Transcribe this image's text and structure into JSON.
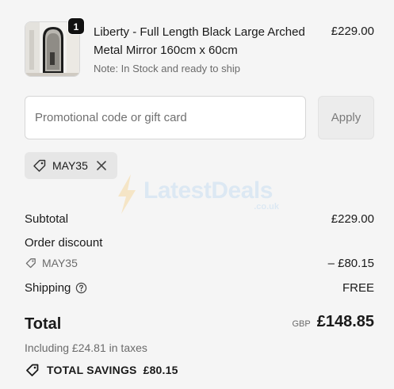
{
  "product": {
    "quantity": "1",
    "title": "Liberty - Full Length Black Large Arched Metal Mirror 160cm x 60cm",
    "note": "Note: In Stock and ready to ship",
    "price": "£229.00"
  },
  "promo": {
    "placeholder": "Promotional code or gift card",
    "apply_label": "Apply",
    "applied_code": "MAY35"
  },
  "watermark": {
    "brand": "LatestDeals",
    "domain": ".co.uk"
  },
  "summary": {
    "subtotal_label": "Subtotal",
    "subtotal_value": "£229.00",
    "order_discount_label": "Order discount",
    "discount_code": "MAY35",
    "discount_value": "– £80.15",
    "shipping_label": "Shipping",
    "shipping_value": "FREE",
    "total_label": "Total",
    "currency": "GBP",
    "total_value": "£148.85",
    "taxes_note": "Including £24.81 in taxes",
    "savings_label": "TOTAL SAVINGS",
    "savings_value": "£80.15"
  },
  "colors": {
    "background": "#f5f5f5",
    "text": "#1a1a1a",
    "muted": "#6b6b6b",
    "chip_bg": "#e6e6e6",
    "badge_bg": "#111111"
  }
}
